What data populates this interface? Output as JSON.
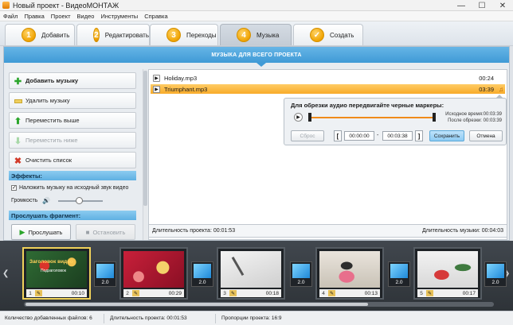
{
  "window": {
    "title": "Новый проект - ВидеоМОНТАЖ",
    "minimize": "—",
    "maximize": "☐",
    "close": "✕"
  },
  "menu": [
    "Файл",
    "Правка",
    "Проект",
    "Видео",
    "Инструменты",
    "Справка"
  ],
  "tabs": [
    {
      "num": "1",
      "label": "Добавить"
    },
    {
      "num": "2",
      "label": "Редактировать"
    },
    {
      "num": "3",
      "label": "Переходы"
    },
    {
      "num": "4",
      "label": "Музыка"
    },
    {
      "num": "✓",
      "label": "Создать"
    }
  ],
  "banner": "МУЗЫКА ДЛЯ ВСЕГО ПРОЕКТА",
  "left": {
    "add_music": "Добавить музыку",
    "delete_music": "Удалить музыку",
    "move_up": "Переместить выше",
    "move_down": "Переместить ниже",
    "clear_list": "Очистить список",
    "effects_head": "Эффекты:",
    "overlay_label": "Наложить музыку на исходный звук видео",
    "volume_label": "Громкость",
    "preview_head": "Прослушать фрагмент:",
    "listen": "Прослушать",
    "stop": "Остановить"
  },
  "tracks": [
    {
      "name": "Holiday.mp3",
      "duration": "00:24"
    },
    {
      "name": "Triumphant.mp3",
      "duration": "03:39"
    }
  ],
  "popup": {
    "title": "Для обрезки аудио передвигайте черные маркеры:",
    "original_time": "Исходное время:00:03:39",
    "after_trim": "После обрезки: 00:03:39",
    "reset": "Сброс",
    "start": "00:00:00",
    "dash": "-",
    "end": "00:03:38",
    "save": "Сохранить",
    "cancel": "Отмена",
    "bracket_left": "[",
    "bracket_right": "]"
  },
  "duration_bar": {
    "project": "Длительность проекта: 00:01:53",
    "music": "Длительность музыки: 00:04:03"
  },
  "clips": [
    {
      "index": "1",
      "time": "00:10",
      "title_text": "Заголовок видео",
      "subtitle_text": "Подзаголовок"
    },
    {
      "index": "2",
      "time": "00:29"
    },
    {
      "index": "3",
      "time": "00:18"
    },
    {
      "index": "4",
      "time": "00:13"
    },
    {
      "index": "5",
      "time": "00:17"
    }
  ],
  "transitions": [
    "2.0",
    "2.0",
    "2.0",
    "2.0",
    "2.0"
  ],
  "status": {
    "files": "Количество добавленных файлов: 6",
    "duration": "Длительность проекта: 00:01:53",
    "aspect": "Пропорции проекта: 16:9"
  },
  "colors": {
    "accent": "#3f9ad6",
    "selection": "#f8ab2a",
    "tab_badge": "#f0a300"
  }
}
